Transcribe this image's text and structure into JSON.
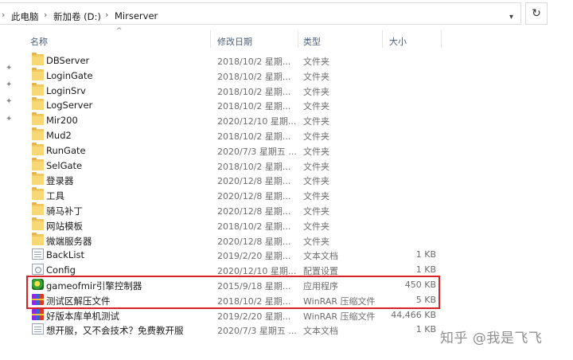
{
  "address": {
    "crumbs": [
      "此电脑",
      "新加卷 (D:)",
      "Mirserver"
    ],
    "dropdown_icon": "chevron-down-icon",
    "refresh_icon": "refresh-icon"
  },
  "columns": {
    "name": "名称",
    "date": "修改日期",
    "type": "类型",
    "size": "大小"
  },
  "files": [
    {
      "name": "DBServer",
      "date": "2018/10/2 星期...",
      "type": "文件夹",
      "size": "",
      "icon": "folder-icon"
    },
    {
      "name": "LoginGate",
      "date": "2018/10/2 星期...",
      "type": "文件夹",
      "size": "",
      "icon": "folder-icon"
    },
    {
      "name": "LoginSrv",
      "date": "2018/10/2 星期...",
      "type": "文件夹",
      "size": "",
      "icon": "folder-icon"
    },
    {
      "name": "LogServer",
      "date": "2018/10/2 星期...",
      "type": "文件夹",
      "size": "",
      "icon": "folder-icon"
    },
    {
      "name": "Mir200",
      "date": "2020/12/10 星期...",
      "type": "文件夹",
      "size": "",
      "icon": "folder-icon"
    },
    {
      "name": "Mud2",
      "date": "2018/10/2 星期...",
      "type": "文件夹",
      "size": "",
      "icon": "folder-icon"
    },
    {
      "name": "RunGate",
      "date": "2020/7/3 星期五 ...",
      "type": "文件夹",
      "size": "",
      "icon": "folder-icon"
    },
    {
      "name": "SelGate",
      "date": "2018/10/2 星期...",
      "type": "文件夹",
      "size": "",
      "icon": "folder-icon"
    },
    {
      "name": "登录器",
      "date": "2020/12/8 星期...",
      "type": "文件夹",
      "size": "",
      "icon": "folder-icon"
    },
    {
      "name": "工具",
      "date": "2020/12/8 星期...",
      "type": "文件夹",
      "size": "",
      "icon": "folder-icon"
    },
    {
      "name": "骑马补丁",
      "date": "2020/12/8 星期...",
      "type": "文件夹",
      "size": "",
      "icon": "folder-icon"
    },
    {
      "name": "网站模板",
      "date": "2018/10/2 星期...",
      "type": "文件夹",
      "size": "",
      "icon": "folder-icon"
    },
    {
      "name": "微端服务器",
      "date": "2020/12/8 星期...",
      "type": "文件夹",
      "size": "",
      "icon": "folder-icon"
    },
    {
      "name": "BackList",
      "date": "2019/2/20 星期...",
      "type": "文本文档",
      "size": "1 KB",
      "icon": "text-document-icon"
    },
    {
      "name": "Config",
      "date": "2020/12/10 星期...",
      "type": "配置设置",
      "size": "1 KB",
      "icon": "config-file-icon"
    },
    {
      "name": "gameofmir引擎控制器",
      "date": "2015/9/18 星期...",
      "type": "应用程序",
      "size": "450 KB",
      "icon": "application-icon"
    },
    {
      "name": "测试区解压文件",
      "date": "2018/10/2 星期...",
      "type": "WinRAR 压缩文件",
      "size": "5 KB",
      "icon": "winrar-archive-icon"
    },
    {
      "name": "好版本库单机测试",
      "date": "2019/2/20 星期...",
      "type": "WinRAR 压缩文件",
      "size": "44,466 KB",
      "icon": "winrar-archive-icon"
    },
    {
      "name": "想开服，又不会技术？免费教开服",
      "date": "2020/7/3 星期五 ...",
      "type": "文本文档",
      "size": "1 KB",
      "icon": "text-document-icon"
    }
  ],
  "watermark": "知乎 @我是飞飞",
  "colors": {
    "highlight_box": "#d8232a",
    "folder": "#f8d775",
    "header_text": "#4c607a"
  }
}
